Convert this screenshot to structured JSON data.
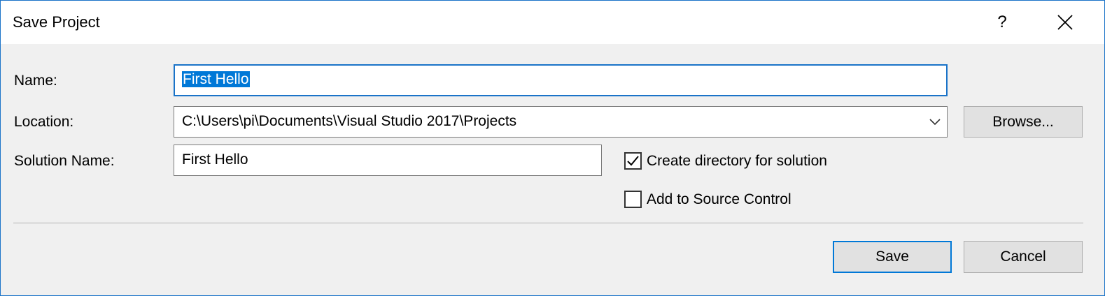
{
  "dialog": {
    "title": "Save Project",
    "help_label": "?"
  },
  "form": {
    "name_label": "Name:",
    "name_value": "First Hello",
    "location_label": "Location:",
    "location_value": "C:\\Users\\pi\\Documents\\Visual Studio 2017\\Projects",
    "solution_name_label": "Solution Name:",
    "solution_name_value": "First Hello",
    "browse_label": "Browse...",
    "create_directory_label": "Create directory for solution",
    "create_directory_checked": true,
    "source_control_label": "Add to Source Control",
    "source_control_checked": false
  },
  "footer": {
    "save_label": "Save",
    "cancel_label": "Cancel"
  },
  "colors": {
    "accent": "#0078d7",
    "window_border": "#1a73c8",
    "dialog_background": "#f0f0f0"
  },
  "icons": {
    "close": "close-icon",
    "dropdown": "chevron-down-icon",
    "check": "checkmark-icon"
  }
}
